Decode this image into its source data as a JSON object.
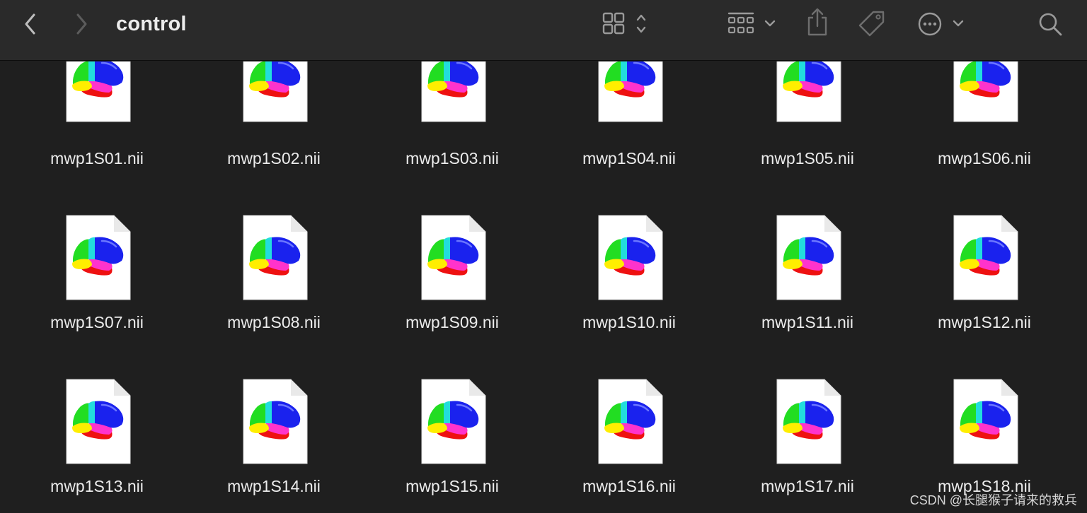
{
  "window": {
    "title": "control"
  },
  "toolbar": {
    "back": "chevron-left-icon",
    "forward": "chevron-right-icon",
    "view_toggle": "grid-view-icon",
    "group_by": "group-grid-icon",
    "share": "share-icon",
    "tags": "tag-icon",
    "more": "ellipsis-circle-icon",
    "search": "search-icon"
  },
  "files": [
    {
      "name": "mwp1S01.nii"
    },
    {
      "name": "mwp1S02.nii"
    },
    {
      "name": "mwp1S03.nii"
    },
    {
      "name": "mwp1S04.nii"
    },
    {
      "name": "mwp1S05.nii"
    },
    {
      "name": "mwp1S06.nii"
    },
    {
      "name": "mwp1S07.nii"
    },
    {
      "name": "mwp1S08.nii"
    },
    {
      "name": "mwp1S09.nii"
    },
    {
      "name": "mwp1S10.nii"
    },
    {
      "name": "mwp1S11.nii"
    },
    {
      "name": "mwp1S12.nii"
    },
    {
      "name": "mwp1S13.nii"
    },
    {
      "name": "mwp1S14.nii"
    },
    {
      "name": "mwp1S15.nii"
    },
    {
      "name": "mwp1S16.nii"
    },
    {
      "name": "mwp1S17.nii"
    },
    {
      "name": "mwp1S18.nii"
    }
  ],
  "watermark": "CSDN @长腿猴子请来的救兵",
  "colors": {
    "background": "#1f1f1f",
    "toolbar": "#2a2a2a",
    "text": "#ececec",
    "icon": "#9a9a9a"
  }
}
